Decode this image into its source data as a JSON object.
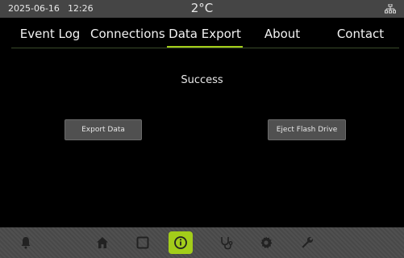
{
  "status_bar": {
    "date": "2025-06-16",
    "time": "12:26",
    "temperature": "2°C",
    "network_icon": "network-icon"
  },
  "tabs": [
    {
      "label": "Event Log",
      "active": false
    },
    {
      "label": "Connections",
      "active": false
    },
    {
      "label": "Data Export",
      "active": true
    },
    {
      "label": "About",
      "active": false
    },
    {
      "label": "Contact",
      "active": false
    }
  ],
  "main": {
    "status_message": "Success",
    "export_button": "Export Data",
    "eject_button": "Eject Flash Drive"
  },
  "bottom_nav": [
    {
      "icon": "bell-icon",
      "active": false
    },
    {
      "icon": "home-icon",
      "active": false
    },
    {
      "icon": "square-icon",
      "active": false
    },
    {
      "icon": "info-icon",
      "active": true
    },
    {
      "icon": "stethoscope-icon",
      "active": false
    },
    {
      "icon": "gear-icon",
      "active": false
    },
    {
      "icon": "wrench-icon",
      "active": false
    }
  ],
  "colors": {
    "accent": "#a3cd1a",
    "status_bar": "#454545",
    "bottom_bar": "#4a4a4a",
    "background": "#000000"
  }
}
